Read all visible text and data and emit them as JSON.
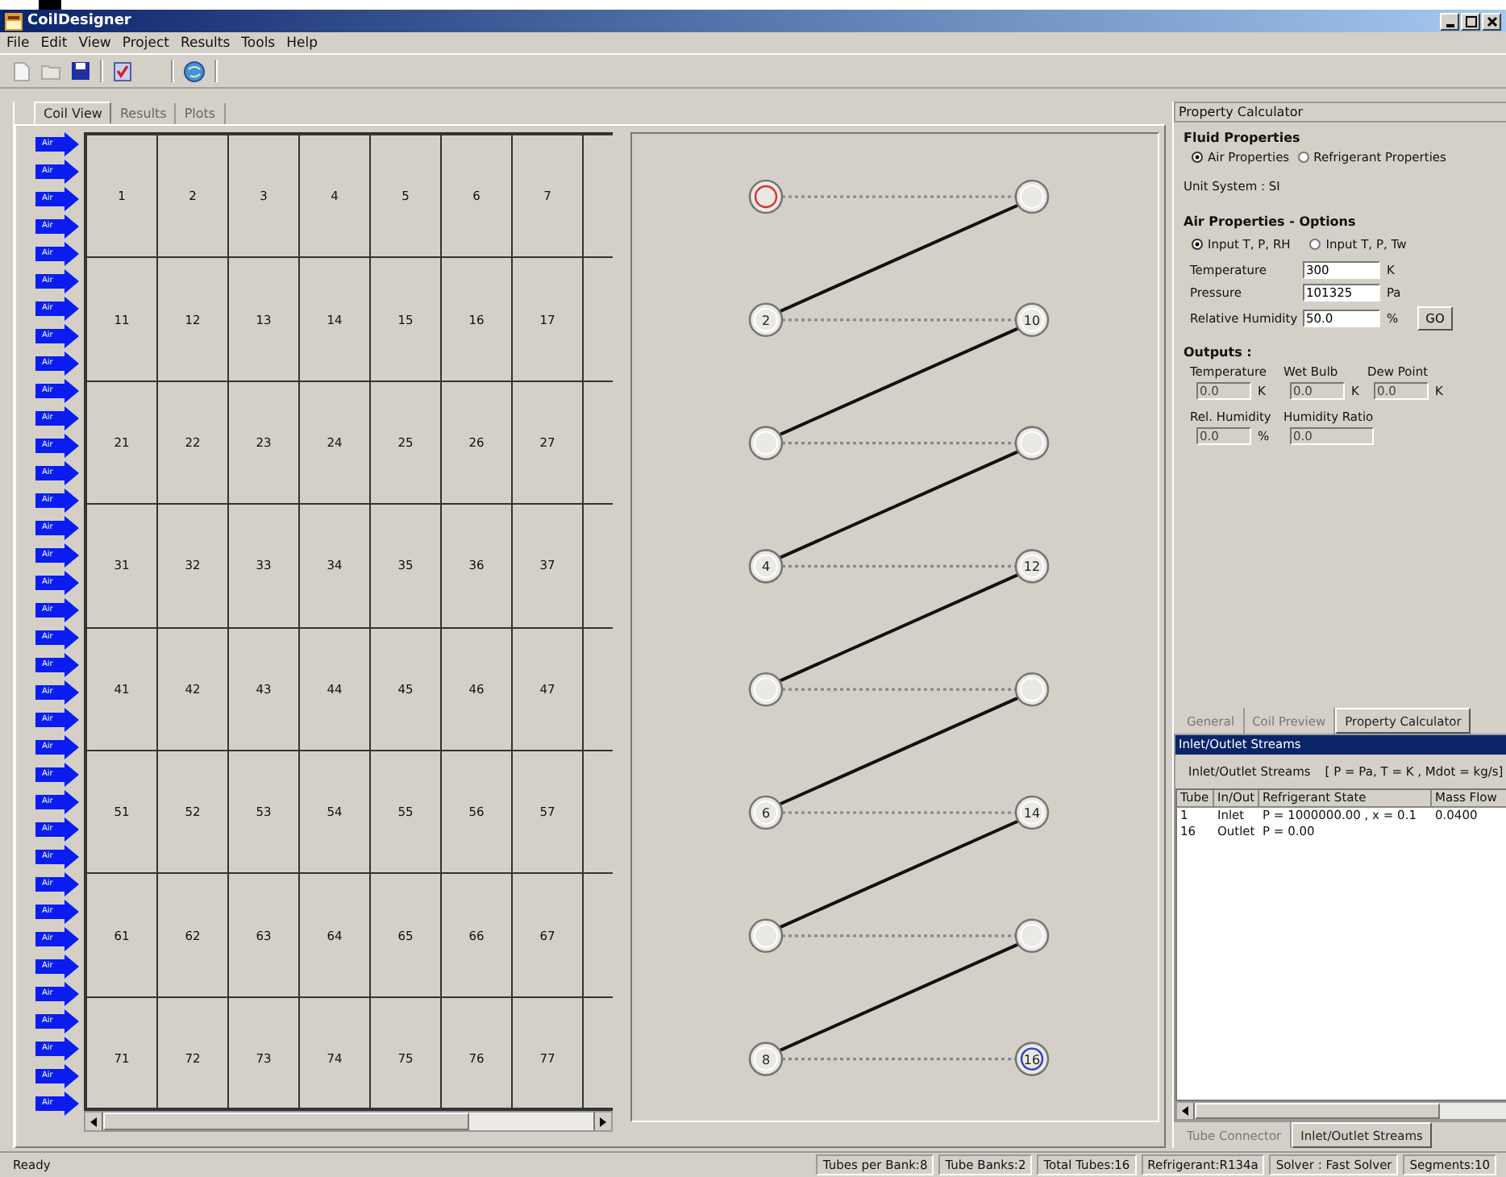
{
  "window": {
    "title": "CoilDesigner"
  },
  "menu": [
    "File",
    "Edit",
    "View",
    "Project",
    "Results",
    "Tools",
    "Help"
  ],
  "main_tabs": [
    {
      "label": "Coil View",
      "selected": true
    },
    {
      "label": "Results",
      "selected": false
    },
    {
      "label": "Plots",
      "selected": false
    }
  ],
  "air_arrows": [
    "Air",
    "Air",
    "Air",
    "Air",
    "Air",
    "Air",
    "Air",
    "Air",
    "Air",
    "Air",
    "Air",
    "Air",
    "Air",
    "Air",
    "Air",
    "Air",
    "Air",
    "Air",
    "Air",
    "Air",
    "Air",
    "Air",
    "Air",
    "Air",
    "Air",
    "Air",
    "Air",
    "Air",
    "Air",
    "Air",
    "Air",
    "Air",
    "Air",
    "Air",
    "Air",
    "Air"
  ],
  "tube_grid": [
    [
      "1",
      "2",
      "3",
      "4",
      "5",
      "6",
      "7"
    ],
    [
      "11",
      "12",
      "13",
      "14",
      "15",
      "16",
      "17"
    ],
    [
      "21",
      "22",
      "23",
      "24",
      "25",
      "26",
      "27"
    ],
    [
      "31",
      "32",
      "33",
      "34",
      "35",
      "36",
      "37"
    ],
    [
      "41",
      "42",
      "43",
      "44",
      "45",
      "46",
      "47"
    ],
    [
      "51",
      "52",
      "53",
      "54",
      "55",
      "56",
      "57"
    ],
    [
      "61",
      "62",
      "63",
      "64",
      "65",
      "66",
      "67"
    ],
    [
      "71",
      "72",
      "73",
      "74",
      "75",
      "76",
      "77"
    ]
  ],
  "coil_preview": [
    {
      "left": {
        "kind": "inlet"
      },
      "right": {
        "kind": "tube"
      }
    },
    {
      "left": {
        "label": "2",
        "kind": "tube"
      },
      "right": {
        "label": "10",
        "kind": "tube"
      }
    },
    {
      "left": {
        "kind": "tube"
      },
      "right": {
        "kind": "tube"
      }
    },
    {
      "left": {
        "label": "4",
        "kind": "tube"
      },
      "right": {
        "label": "12",
        "kind": "tube"
      }
    },
    {
      "left": {
        "kind": "tube"
      },
      "right": {
        "kind": "tube"
      }
    },
    {
      "left": {
        "label": "6",
        "kind": "tube"
      },
      "right": {
        "label": "14",
        "kind": "tube"
      }
    },
    {
      "left": {
        "kind": "tube"
      },
      "right": {
        "kind": "tube"
      }
    },
    {
      "left": {
        "label": "8",
        "kind": "tube"
      },
      "right": {
        "label": "16",
        "kind": "outlet"
      }
    }
  ],
  "property_calculator": {
    "title": "Property Calculator",
    "fluid_heading": "Fluid Properties",
    "fluid_options": [
      {
        "label": "Air Properties",
        "selected": true
      },
      {
        "label": "Refrigerant Properties",
        "selected": false
      }
    ],
    "unit_system": "Unit System : SI",
    "options_heading": "Air Properties - Options",
    "input_modes": [
      {
        "label": "Input T, P, RH",
        "selected": true
      },
      {
        "label": "Input T, P, Tw",
        "selected": false
      }
    ],
    "inputs": [
      {
        "label": "Temperature",
        "value": "300",
        "unit": "K"
      },
      {
        "label": "Pressure",
        "value": "101325",
        "unit": "Pa"
      },
      {
        "label": "Relative Humidity",
        "value": "50.0",
        "unit": "%"
      }
    ],
    "go_button": "GO",
    "outputs_heading": "Outputs :",
    "outputs": [
      {
        "label": "Temperature",
        "value": "0.0",
        "unit": "K"
      },
      {
        "label": "Wet Bulb",
        "value": "0.0",
        "unit": "K"
      },
      {
        "label": "Dew Point",
        "value": "0.0",
        "unit": "K"
      },
      {
        "label": "Rel. Humidity",
        "value": "0.0",
        "unit": "%"
      },
      {
        "label": "Humidity Ratio",
        "value": "0.0"
      }
    ]
  },
  "side_tabs": [
    {
      "label": "General",
      "selected": false
    },
    {
      "label": "Coil Preview",
      "selected": false
    },
    {
      "label": "Property Calculator",
      "selected": true
    }
  ],
  "streams": {
    "title": "Inlet/Outlet Streams",
    "caption": "Inlet/Outlet Streams",
    "units": "[ P = Pa, T = K , Mdot = kg/s]",
    "columns": [
      "Tube",
      "In/Out",
      "Refrigerant State",
      "Mass Flow"
    ],
    "rows": [
      [
        "1",
        "Inlet",
        "P = 1000000.00 , x = 0.1",
        "0.0400"
      ],
      [
        "16",
        "Outlet",
        "P = 0.00",
        ""
      ]
    ]
  },
  "bottom_tabs": [
    {
      "label": "Tube Connector",
      "selected": false
    },
    {
      "label": "Inlet/Outlet Streams",
      "selected": true
    }
  ],
  "status_bar": [
    "Ready",
    "Tubes per Bank:8",
    "Tube Banks:2",
    "Total Tubes:16",
    "Refrigerant:R134a",
    "Solver : Fast Solver",
    "Segments:10"
  ]
}
